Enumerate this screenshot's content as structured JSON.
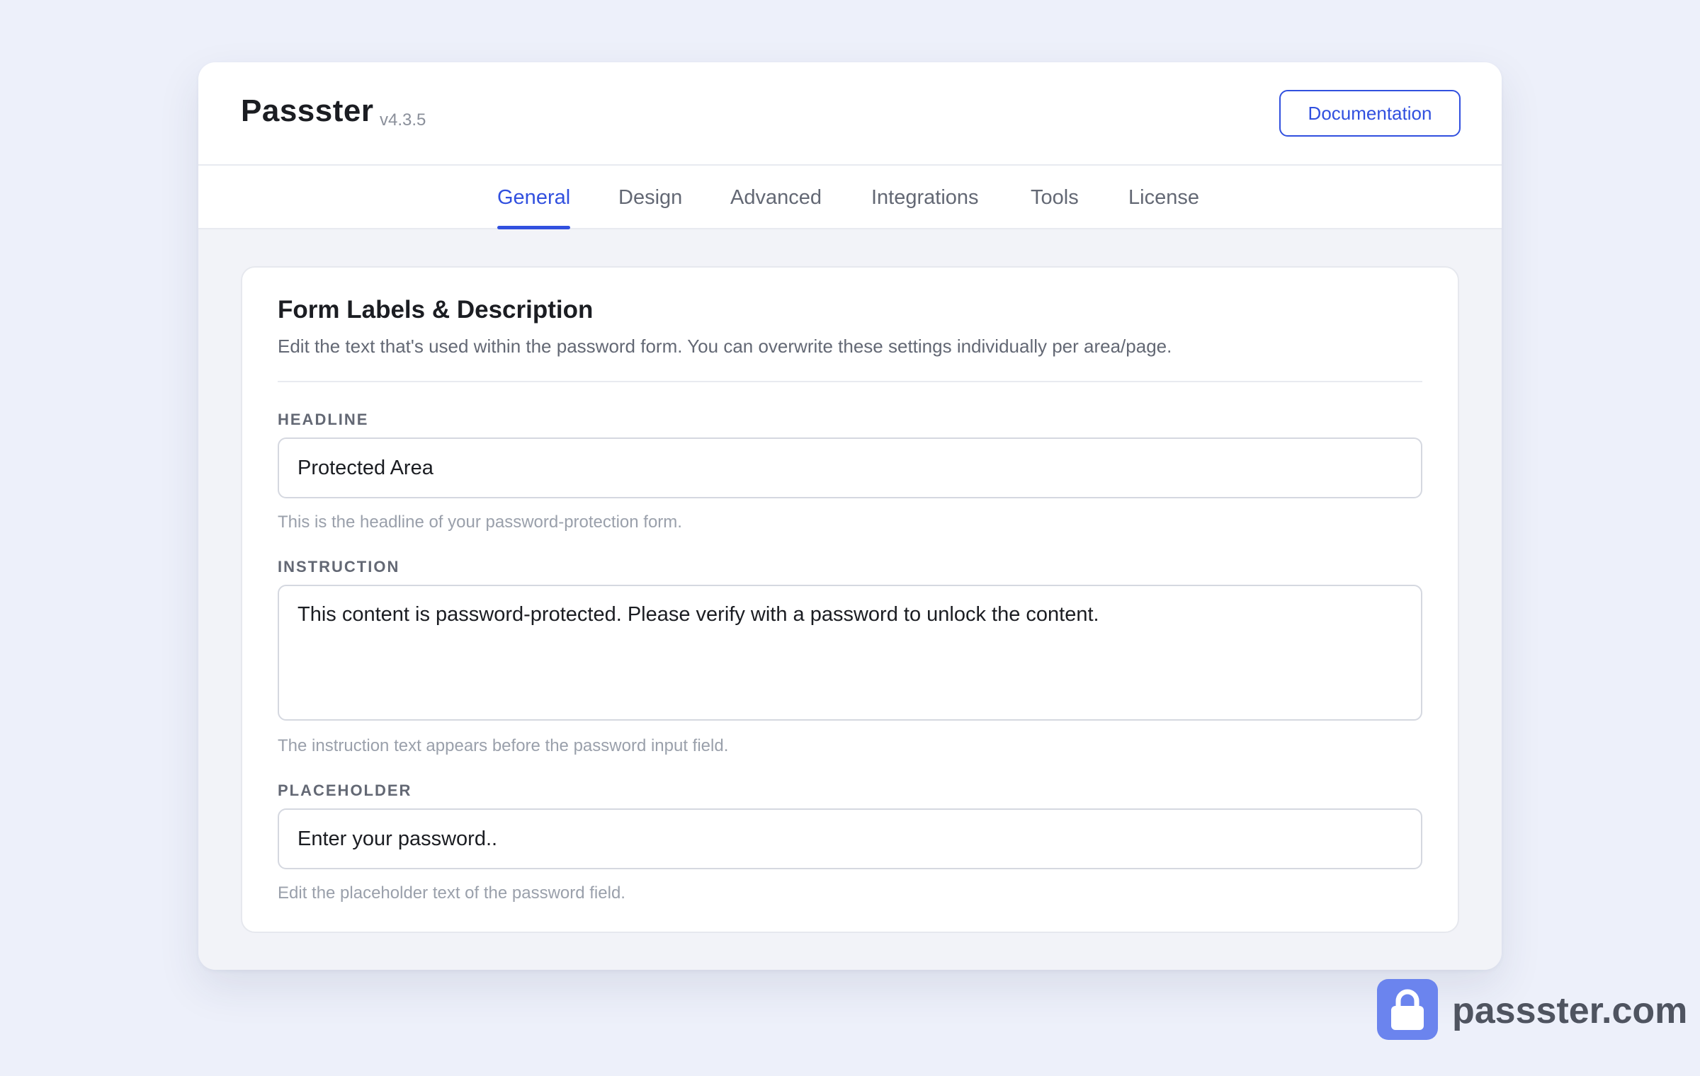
{
  "app": {
    "title": "Passster",
    "version": "v4.3.5",
    "doc_button_label": "Documentation"
  },
  "tabs": [
    {
      "label": "General",
      "active": true
    },
    {
      "label": "Design",
      "active": false
    },
    {
      "label": "Advanced",
      "active": false
    },
    {
      "label": "Integrations",
      "active": false
    },
    {
      "label": "Tools",
      "active": false
    },
    {
      "label": "License",
      "active": false
    }
  ],
  "section": {
    "title": "Form Labels & Description",
    "description": "Edit the text that's used within the password form. You can overwrite these settings individually per area/page."
  },
  "fields": {
    "headline": {
      "label": "HEADLINE",
      "value": "Protected Area",
      "help": "This is the headline of your password-protection form."
    },
    "instruction": {
      "label": "INSTRUCTION",
      "value": "This content is password-protected. Please verify with a password to unlock the content.",
      "help": "The instruction text appears before the password input field."
    },
    "placeholder": {
      "label": "PLACEHOLDER",
      "value": "Enter your password..",
      "help": "Edit the placeholder text of the password field."
    }
  },
  "branding": {
    "icon": "lock-icon",
    "text": "passster.com"
  },
  "colors": {
    "accent": "#3150df",
    "badge": "#6b84ee",
    "background": "#edf0fa"
  }
}
